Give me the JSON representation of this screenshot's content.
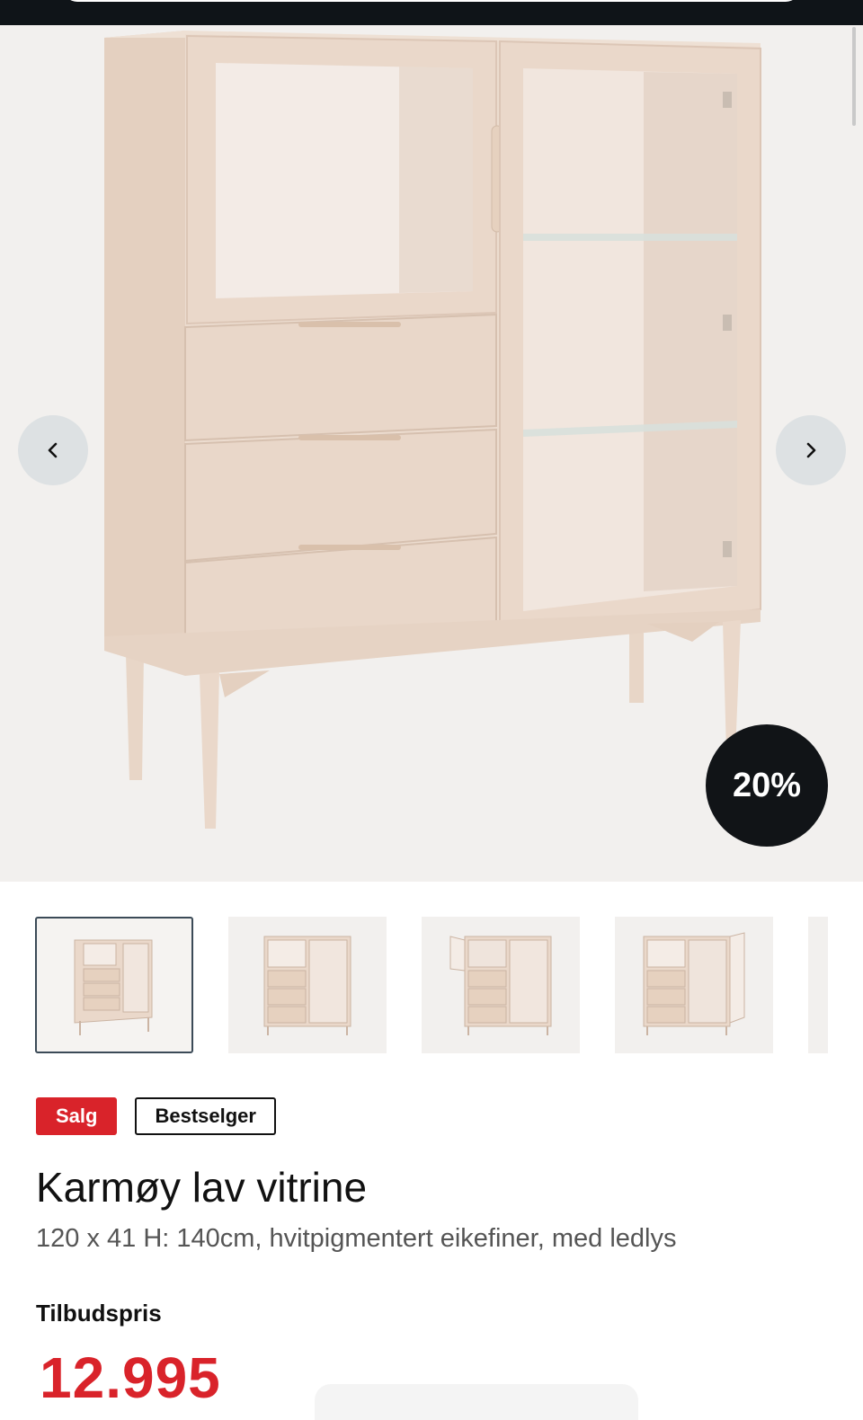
{
  "gallery": {
    "prev_icon": "chevron-left-icon",
    "next_icon": "chevron-right-icon",
    "discount_badge": "20%"
  },
  "thumbnails": [
    {
      "view": "front-doors-closed",
      "active": true
    },
    {
      "view": "front-doors-closed",
      "active": false
    },
    {
      "view": "left-door-open",
      "active": false
    },
    {
      "view": "right-door-open",
      "active": false
    },
    {
      "view": "partial",
      "active": false
    }
  ],
  "badges": {
    "sale": "Salg",
    "bestseller": "Bestselger"
  },
  "product": {
    "title": "Karmøy lav vitrine",
    "description": "120 x 41 H: 140cm, hvitpigmentert eikefiner, med ledlys",
    "price_label": "Tilbudspris",
    "price": "12.995"
  },
  "colors": {
    "sale_red": "#d9232a",
    "badge_dark": "#111417",
    "gallery_bg": "#f2f0ee",
    "wood": "#ead9cb"
  }
}
